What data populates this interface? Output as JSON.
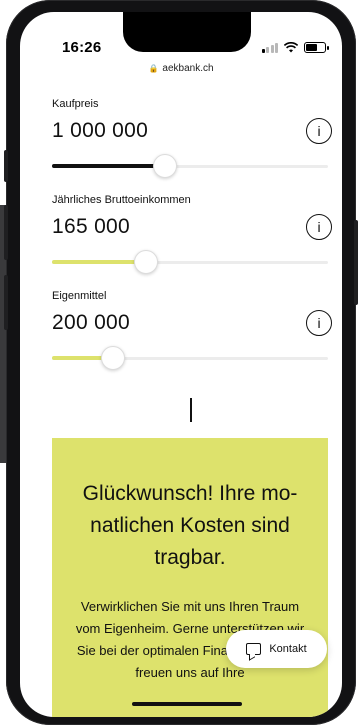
{
  "status_bar": {
    "time": "16:26"
  },
  "browser": {
    "url": "aekbank.ch"
  },
  "calculator": {
    "fields": [
      {
        "label": "Kaufpreis",
        "value": "1 000 000",
        "slider_fraction": 0.41,
        "fill_color": "#111111"
      },
      {
        "label": "Jährliches Bruttoeinkommen",
        "value": "165 000",
        "slider_fraction": 0.34,
        "fill_color": "#dde26c"
      },
      {
        "label": "Eigenmittel",
        "value": "200 000",
        "slider_fraction": 0.22,
        "fill_color": "#dde26c"
      }
    ],
    "info_label": "i"
  },
  "result": {
    "title": "Glückwunsch! Ihre mo-natlichen Kosten sind tragbar.",
    "body": "Verwirklichen Sie mit uns Ihren Traum vom Eigenheim. Gerne unterstützen wir Sie bei der optimalen Finanzierung und freuen uns auf Ihre",
    "background": "#dde26c"
  },
  "contact_button": {
    "label": "Kontakt",
    "icon": "chat-icon"
  }
}
